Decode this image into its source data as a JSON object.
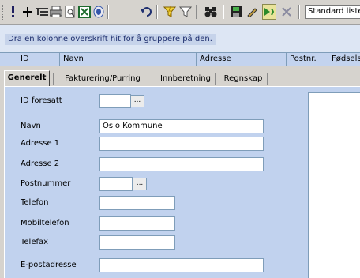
{
  "toolbar": {
    "icons": [
      "exclamation-icon",
      "add-icon",
      "indent-icon",
      "print-icon",
      "print-preview-icon",
      "excel-icon",
      "outlook-icon",
      "undo-icon",
      "filter-clear-icon",
      "filter-icon",
      "binoculars-icon",
      "save-icon",
      "edit-pencil-icon",
      "run-next-icon",
      "cancel-icon"
    ],
    "list_combo_value": "Standard liste"
  },
  "grid": {
    "group_hint": "Dra en kolonne overskrift hit for å gruppere på den.",
    "columns": [
      "ID",
      "Navn",
      "Adresse",
      "Postnr.",
      "Fødsels"
    ]
  },
  "tabs": [
    {
      "label": "Generelt",
      "active": true
    },
    {
      "label": "Fakturering/Purring",
      "active": false
    },
    {
      "label": "Innberetning",
      "active": false
    },
    {
      "label": "Regnskap",
      "active": false
    }
  ],
  "form": {
    "id_label": "ID foresatt",
    "id_value": "",
    "navn_label": "Navn",
    "navn_value": "Oslo Kommune",
    "adresse1_label": "Adresse 1",
    "adresse1_value": "",
    "adresse2_label": "Adresse 2",
    "adresse2_value": "",
    "postnummer_label": "Postnummer",
    "postnummer_value": "",
    "telefon_label": "Telefon",
    "telefon_value": "",
    "mobil_label": "Mobiltelefon",
    "mobil_value": "",
    "telefax_label": "Telefax",
    "telefax_value": "",
    "epost_label": "E-postadresse",
    "epost_value": "",
    "browse_button": "..."
  }
}
